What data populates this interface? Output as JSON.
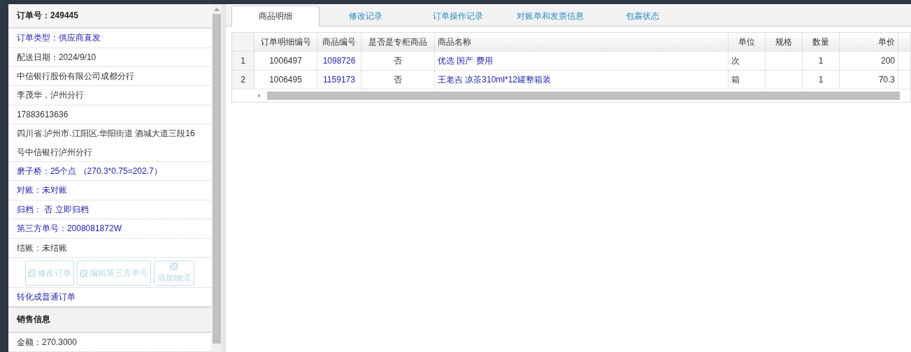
{
  "order_panel": {
    "title": "订单号：249445",
    "rows": [
      {
        "kind": "link",
        "text": "订单类型：供应商直发"
      },
      {
        "kind": "text",
        "text": "配送日期：2024/9/10"
      },
      {
        "kind": "text",
        "text": "中信银行股份有限公司成都分行"
      },
      {
        "kind": "text",
        "text": "李茂华，泸州分行"
      },
      {
        "kind": "text",
        "text": "17883613636"
      },
      {
        "kind": "text",
        "text": "四川省.泸州市.江阳区.华阳街道 酒城大道三段16号中信银行泸州分行"
      },
      {
        "kind": "link",
        "text": "磨子桥：25个点 （270.3*0.75=202.7）"
      },
      {
        "kind": "link",
        "text": "对账：未对账"
      },
      {
        "kind": "link",
        "text": "归档：  否 立即归档"
      },
      {
        "kind": "link",
        "text": "第三方单号：2008081872W"
      },
      {
        "kind": "text",
        "text": "结账：未结账"
      }
    ],
    "buttons": [
      {
        "label": "修改订单",
        "disabled": true
      },
      {
        "label": "编辑第三方单号",
        "disabled": true
      },
      {
        "label": "添加物流",
        "disabled": true
      }
    ],
    "convert_link": "转化成普通订单",
    "sales_title": "销售信息",
    "amount": "金额：270.3000"
  },
  "tabs": [
    {
      "label": "商品明细",
      "selected": true
    },
    {
      "label": "修改记录",
      "selected": false
    },
    {
      "label": "订单操作记录",
      "selected": false
    },
    {
      "label": "对账单和发票信息",
      "selected": false
    },
    {
      "label": "包裹状态",
      "selected": false
    }
  ],
  "table": {
    "columns": [
      "订单明细编号",
      "商品编号",
      "是否是专柜商品",
      "商品名称",
      "单位",
      "规格",
      "数量",
      "单价"
    ],
    "rows": [
      {
        "index": "1",
        "cells": [
          "1006497",
          "1098726",
          "否",
          "优选 国产 费用",
          "次",
          "",
          "1",
          "200"
        ]
      },
      {
        "index": "2",
        "cells": [
          "1006495",
          "1159173",
          "否",
          "王老吉 凉茶310ml*12罐整箱装",
          "箱",
          "",
          "1",
          "70.3"
        ]
      }
    ]
  }
}
